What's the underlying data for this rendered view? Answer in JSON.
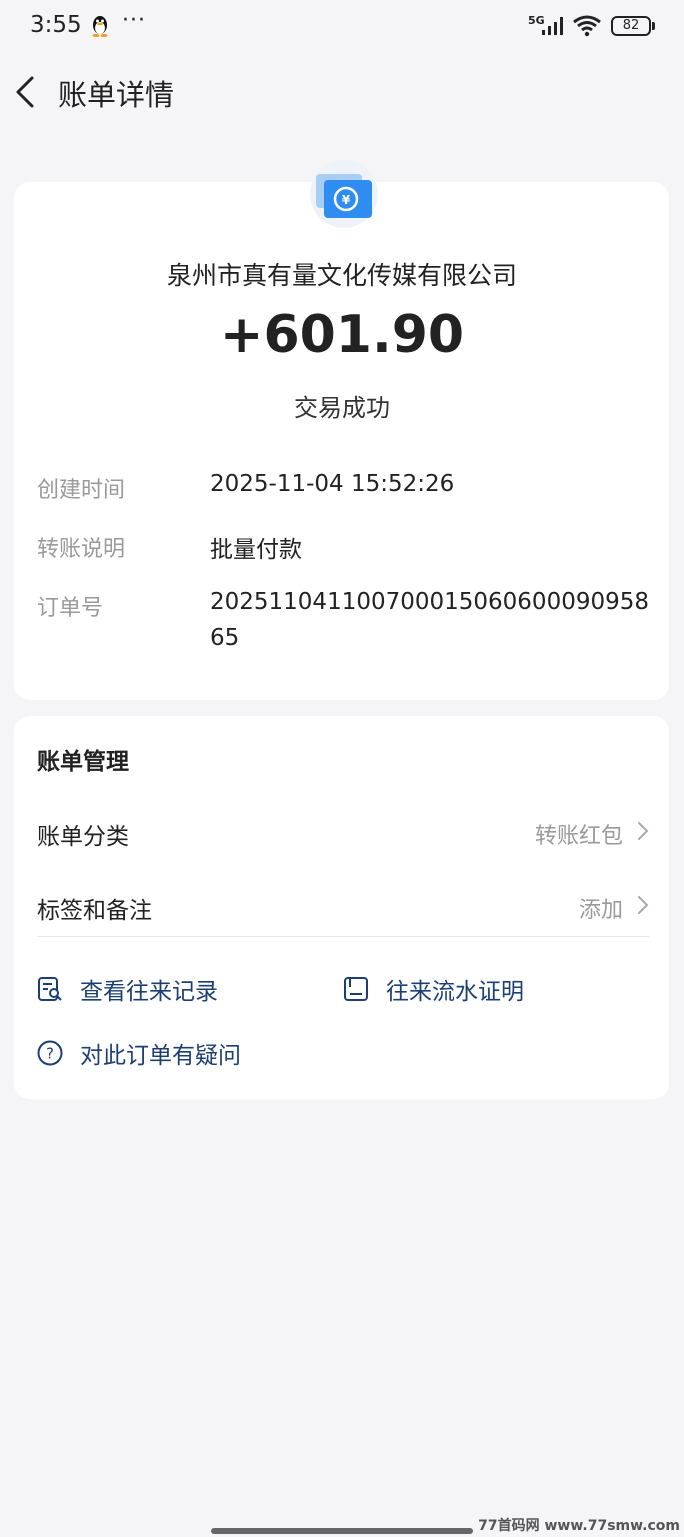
{
  "status_bar": {
    "time": "3:55",
    "more": "···",
    "network": "5G",
    "battery": "82"
  },
  "nav": {
    "title": "账单详情"
  },
  "detail": {
    "payer": "泉州市真有量文化传媒有限公司",
    "amount": "+601.90",
    "status": "交易成功",
    "rows": [
      {
        "label": "创建时间",
        "value": "2025-11-04 15:52:26"
      },
      {
        "label": "转账说明",
        "value": "批量付款"
      },
      {
        "label": "订单号",
        "value": "20251104110070001506060009095865"
      }
    ]
  },
  "manage": {
    "title": "账单管理",
    "items": [
      {
        "label": "账单分类",
        "value": "转账红包"
      },
      {
        "label": "标签和备注",
        "value": "添加"
      }
    ],
    "actions": [
      {
        "label": "查看往来记录",
        "icon": "record-search-icon"
      },
      {
        "label": "往来流水证明",
        "icon": "statement-icon"
      },
      {
        "label": "对此订单有疑问",
        "icon": "question-icon"
      }
    ]
  },
  "watermark": "77首码网 www.77smw.com",
  "colors": {
    "accent_blue": "#1c3f73",
    "icon_blue": "#2f8cf0",
    "muted_text": "#9a9a9a",
    "background": "#f5f5f7"
  }
}
